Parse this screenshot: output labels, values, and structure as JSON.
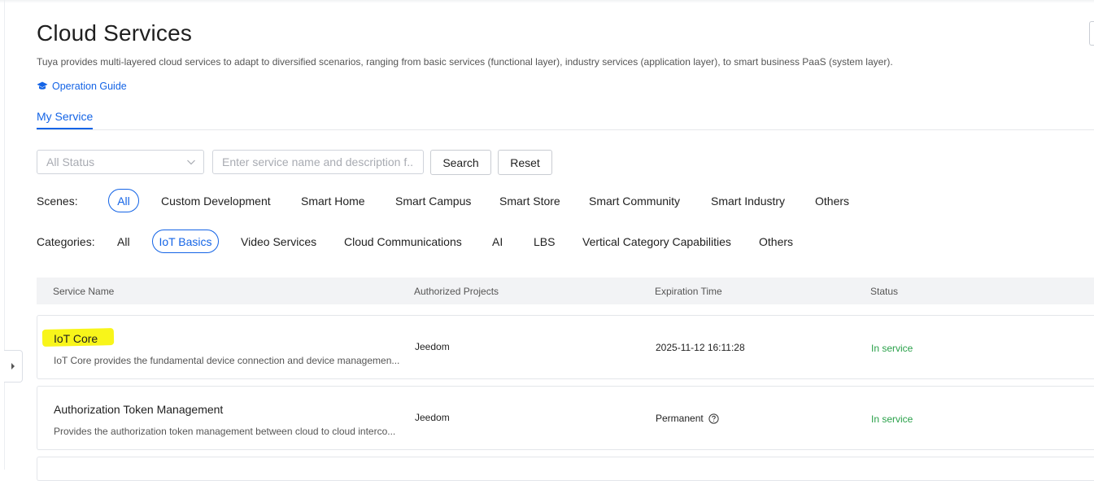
{
  "page": {
    "title": "Cloud Services",
    "description": "Tuya provides multi-layered cloud services to adapt to diversified scenarios, ranging from basic services (functional layer), industry services (application layer), to smart business PaaS (system layer).",
    "guide_label": "Operation Guide",
    "guide_icon": "graduation-cap-icon"
  },
  "tabs": [
    {
      "label": "My Service",
      "active": true
    }
  ],
  "filters": {
    "status_select": {
      "value": "All Status",
      "options_visible": [
        "All Status"
      ]
    },
    "search": {
      "placeholder": "Enter service name and description f...",
      "value": ""
    },
    "search_button": "Search",
    "reset_button": "Reset"
  },
  "scenes": {
    "label": "Scenes:",
    "items": [
      "All",
      "Custom Development",
      "Smart Home",
      "Smart Campus",
      "Smart Store",
      "Smart Community",
      "Smart Industry",
      "Others"
    ],
    "active": "All"
  },
  "categories": {
    "label": "Categories:",
    "items": [
      "All",
      "IoT Basics",
      "Video Services",
      "Cloud Communications",
      "AI",
      "LBS",
      "Vertical Category Capabilities",
      "Others"
    ],
    "active": "IoT Basics"
  },
  "table": {
    "columns": [
      "Service Name",
      "Authorized Projects",
      "Expiration Time",
      "Status"
    ],
    "rows": [
      {
        "name": "IoT Core",
        "description": "IoT Core provides the fundamental device connection and device managemen...",
        "project": "Jeedom",
        "expiration": "2025-11-12 16:11:28",
        "status": "In service",
        "highlighted": true
      },
      {
        "name": "Authorization Token Management",
        "description": "Provides the authorization token management between cloud to cloud interco...",
        "project": "Jeedom",
        "expiration": "Permanent",
        "expiration_icon": "question-circle-icon",
        "status": "In service",
        "highlighted": false
      }
    ]
  },
  "colors": {
    "accent": "#1464e6",
    "status_ok": "#2aa14a",
    "highlight": "#f8f51a",
    "header_bg": "#f2f3f5"
  }
}
